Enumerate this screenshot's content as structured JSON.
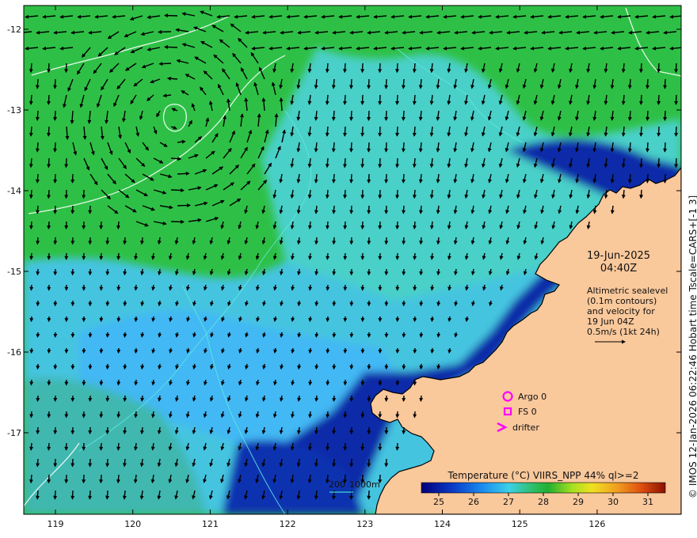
{
  "map": {
    "date": "19-Jun-2025",
    "time": "04:40Z",
    "annotation_lines": [
      "Altimetric sealevel",
      "(0.1m contours)",
      "and velocity for",
      "19 Jun 04Z",
      "0.5m/s (1kt 24h)"
    ],
    "side_caption": "© IMOS 12-Jan-2026 06:22:46 Hobart time Tscale=CARS+[-1 3]",
    "depth_legend": {
      "label_200": "200",
      "label_1000": "1000m",
      "color": "#40d8d0"
    },
    "legend_markers": [
      {
        "label": "Argo 0",
        "icon": "circle-icon",
        "color": "#ff00ff"
      },
      {
        "label": "FS 0",
        "icon": "square-icon",
        "color": "#ff00ff"
      },
      {
        "label": "drifter",
        "icon": "chevron-icon",
        "color": "#ff00ff"
      }
    ],
    "x_ticks": [
      "119",
      "120",
      "121",
      "122",
      "123",
      "124",
      "125",
      "126"
    ],
    "y_ticks": [
      "-12",
      "-13",
      "-14",
      "-15",
      "-16",
      "-17"
    ],
    "colorbar": {
      "title": "Temperature (°C) VIIRS_NPP 44% ql>=2",
      "min": 24.5,
      "max": 31.5,
      "ticks": [
        "25",
        "26",
        "27",
        "28",
        "29",
        "30",
        "31"
      ]
    },
    "colors": {
      "land": "#f9c89b",
      "cold": "#0a1a8c",
      "cool": "#3aa8f0",
      "warm": "#2fc040",
      "contour": "#ffffff"
    }
  }
}
